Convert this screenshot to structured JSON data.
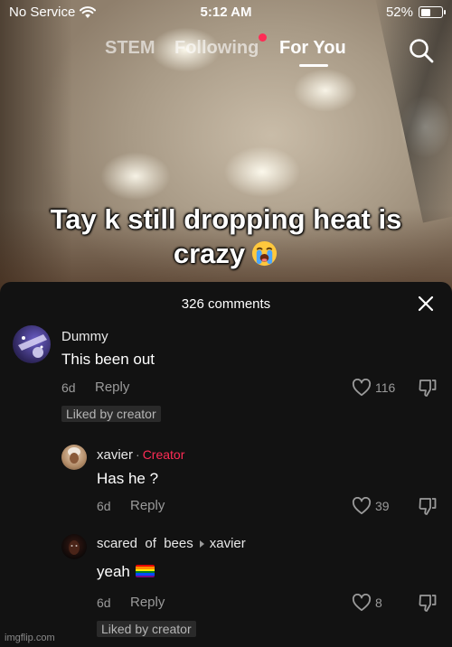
{
  "status_bar": {
    "carrier": "No Service",
    "time": "5:12 AM",
    "battery": "52%",
    "battery_level": 0.52,
    "wifi_icon": "wifi-icon"
  },
  "top_nav": {
    "tabs": [
      {
        "label": "STEM",
        "active": false
      },
      {
        "label": "Following",
        "active": false,
        "has_notification": true
      },
      {
        "label": "For You",
        "active": true
      }
    ],
    "search_icon": "search-icon",
    "notification_color": "#fe2c55"
  },
  "video": {
    "caption_line1": "Tay k still dropping heat is",
    "caption_line2": "crazy",
    "caption_emoji": "loudly-crying-face"
  },
  "comments_sheet": {
    "title": "326 comments",
    "close_icon": "close-icon",
    "comments": [
      {
        "username": "Dummy",
        "text": "This been out",
        "age": "6d",
        "reply_label": "Reply",
        "likes": "116",
        "badge": "Liked by creator"
      },
      {
        "username": "xavier",
        "creator_label": "Creator",
        "text": "Has he ?",
        "age": "6d",
        "reply_label": "Reply",
        "likes": "39"
      },
      {
        "username": "scared  of  bees",
        "reply_to": "xavier",
        "text": "yeah",
        "emoji": "rainbow-flag",
        "age": "6d",
        "reply_label": "Reply",
        "likes": "8",
        "badge": "Liked by creator"
      }
    ]
  },
  "colors": {
    "accent": "#fe2c55",
    "sheet_background": "#121212",
    "muted_text": "#9a9a9a"
  },
  "watermark": "imgflip.com"
}
